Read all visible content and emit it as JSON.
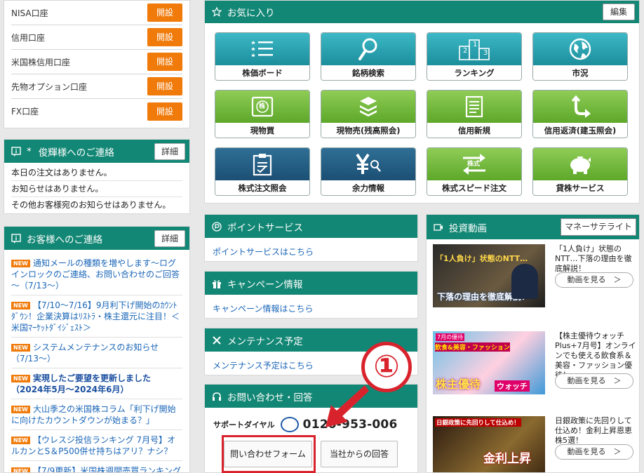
{
  "accounts": [
    {
      "name": "NISA口座",
      "button": "開設"
    },
    {
      "name": "信用口座",
      "button": "開設"
    },
    {
      "name": "米国株信用口座",
      "button": "開設"
    },
    {
      "name": "先物オプション口座",
      "button": "開設"
    },
    {
      "name": "FX口座",
      "button": "開設"
    }
  ],
  "vip": {
    "title": "俊輝様へのご連絡",
    "asterisk": "*",
    "detail": "詳細",
    "lines": [
      "本日の注文はありません。",
      "お知らせはありません。",
      "その他お客様宛のお知らせはありません。"
    ]
  },
  "notices": {
    "title": "お客様へのご連絡",
    "detail": "詳細",
    "badge": "NEW",
    "items": [
      {
        "text": "通知メールの種類を増やします～ログインロックのご連絡、お問い合わせのご回答～（7/13～）",
        "new": true,
        "bold": false
      },
      {
        "text": "【7/10～7/16】9月利下げ開始のｶｳﾝﾄﾀﾞｳﾝ！企業決算はﾘｽﾄﾗ・株主還元に注目！＜米国ﾏｰｹｯﾄﾀﾞｲｼﾞｪｽﾄ＞",
        "new": true,
        "bold": false
      },
      {
        "text": "システムメンテナンスのお知らせ（7/13～）",
        "new": true,
        "bold": false
      },
      {
        "text": "実現したご要望を更新しました（2024年5月～2024年6月）",
        "new": true,
        "bold": true
      },
      {
        "text": "大山季之の米国株コラム「利下げ開始に向けたカウントダウンが始まる？」",
        "new": true,
        "bold": false
      },
      {
        "text": "【ウレスジ投信ランキング 7月号】オルカンとS＆P500併せ持ちはアリ？ナシ？",
        "new": true,
        "bold": false
      },
      {
        "text": "【7/9更新】米国株週間売買ランキング",
        "new": true,
        "bold": false
      }
    ]
  },
  "favorites": {
    "title": "お気に入り",
    "edit": "編集",
    "tiles": [
      {
        "label": "株価ボード",
        "icon": "list-stars-icon",
        "color": "teal"
      },
      {
        "label": "銘柄検索",
        "icon": "magnifier-icon",
        "color": "teal"
      },
      {
        "label": "ランキング",
        "icon": "podium-icon",
        "color": "teal"
      },
      {
        "label": "市況",
        "icon": "globe-icon",
        "color": "teal"
      },
      {
        "label": "現物買",
        "icon": "stock-buy-icon",
        "color": "green"
      },
      {
        "label": "現物売(残高照会)",
        "icon": "stacked-coins-icon",
        "color": "green"
      },
      {
        "label": "信用新規",
        "icon": "document-icon",
        "color": "green"
      },
      {
        "label": "信用返済(建玉照会)",
        "icon": "return-arrow-icon",
        "color": "green"
      },
      {
        "label": "株式注文照会",
        "icon": "clipboard-icon",
        "color": "navy"
      },
      {
        "label": "余力情報",
        "icon": "yen-search-icon",
        "color": "navy"
      },
      {
        "label": "株式スピード注文",
        "icon": "speed-order-icon",
        "color": "green"
      },
      {
        "label": "貸株サービス",
        "icon": "piggy-bank-icon",
        "color": "green"
      }
    ],
    "stock_badge": "株",
    "stock_badge2": "株式",
    "podium": [
      "2",
      "1",
      "3"
    ]
  },
  "points": {
    "title": "ポイントサービス",
    "link": "ポイントサービスはこちら"
  },
  "campaign": {
    "title": "キャンペーン情報",
    "link": "キャンペーン情報はこちら"
  },
  "maintenance": {
    "title": "メンテナンス予定",
    "link": "メンテナンス予定はこちら"
  },
  "contact": {
    "title": "お問い合わせ・回答",
    "dial_label": "サポートダイヤル",
    "number": "0120-953-006",
    "form_button": "問い合わせフォーム",
    "answer_button": "当社からの回答"
  },
  "video": {
    "title": "投資動画",
    "channel_button": "マネーサテライト",
    "items": [
      {
        "text": "「1人負け」状態のNTT…下落の理由を徹底解説！",
        "button": "動画を見る　＞",
        "thumb_caption": "下落の理由を徹底解説！",
        "thumb_top": "「1人負け」状態のNTT…"
      },
      {
        "text": "【株主優待ウォッチPlus+7月号】オンラインでも使える飲食系＆美容・ファッション優待！",
        "button": "動画を見る　＞",
        "thumb_caption": "株主優待",
        "thumb_sub": "ウォッチ",
        "thumb_top": "飲食&美容・ファッション",
        "thumb_month": "7月の優待"
      },
      {
        "text": "日銀政策に先回りして仕込め！金利上昇恩恵株5選！",
        "button": "動画を見る　＞",
        "thumb_caption": "金利上昇",
        "thumb_top": "日銀政策に先回りして仕込め！"
      }
    ]
  },
  "annotation": {
    "number": "①"
  }
}
